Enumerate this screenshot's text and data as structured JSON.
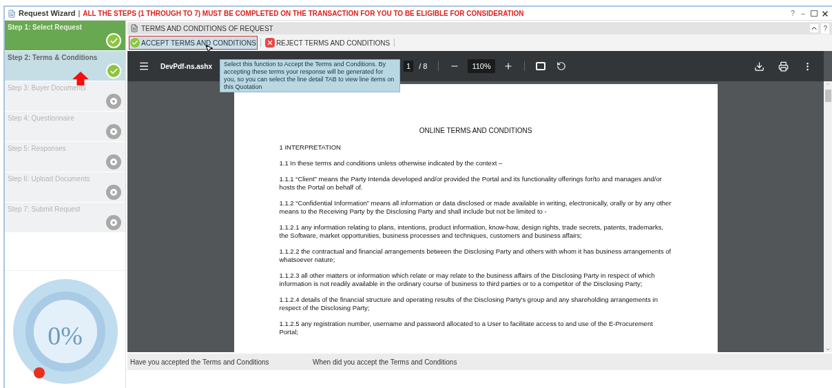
{
  "window": {
    "title": "Request Wizard",
    "separator": "|",
    "notice": "ALL THE STEPS (1 THROUGH TO 7) MUST BE COMPLETED ON THE TRANSACTION FOR YOU TO BE ELIGIBLE FOR CONSIDERATION",
    "controls": [
      "?",
      "–"
    ]
  },
  "steps": [
    {
      "label": "Step 1: Select Request",
      "completed": true,
      "selected": false
    },
    {
      "label": "Step 2: Terms & Conditions",
      "completed": true,
      "selected": true
    },
    {
      "label": "Step 3: Buyer Documents",
      "completed": false,
      "selected": false
    },
    {
      "label": "Step 4: Questionnaire",
      "completed": false,
      "selected": false
    },
    {
      "label": "Step 5: Responses",
      "completed": false,
      "selected": false
    },
    {
      "label": "Step 6: Upload Documents",
      "completed": false,
      "selected": false
    },
    {
      "label": "Step 7: Submit Request",
      "completed": false,
      "selected": false
    }
  ],
  "progress": {
    "text": "0%"
  },
  "panel": {
    "title": "TERMS AND CONDITIONS OF REQUEST",
    "help": "?"
  },
  "actions": [
    {
      "label": "ACCEPT TERMS AND CONDITIONS",
      "kind": "accept",
      "selected": true
    },
    {
      "label": "REJECT TERMS AND CONDITIONS",
      "kind": "reject",
      "selected": false
    }
  ],
  "tooltip": "Select this function to Accept the Terms and Conditions. By accepting these terms your response will be generated for you, so you can select the line detail TAB to view line items on this Quotation",
  "viewer": {
    "file": "DevPdf-ns.ashx",
    "page": "1",
    "pages": "/ 8",
    "zoom": "110%"
  },
  "document": {
    "title": "ONLINE TERMS AND CONDITIONS",
    "heading": "1 INTERPRETATION",
    "paragraphs": [
      "1.1 In these terms and conditions unless otherwise indicated by the context –",
      "1.1.1 “Client” means the Party Intenda developed and/or provided the Portal and its functionality offerings for/to and manages and/or hosts the Portal on behalf of.",
      "1.1.2 “Confidential Information” means all information or data disclosed or made available in writing, electronically, orally or by any other means to the Receiving Party by the Disclosing Party and shall include but not be limited to -",
      "1.1.2.1 any information relating to plans, intentions, product information, know-how, design rights, trade secrets, patents, trademarks, the Software, market opportunities, business processes and techniques, customers and business affairs;",
      "1.1.2.2 the contractual and financial arrangements between the Disclosing Party and others with whom it has business arrangements of whatsoever nature;",
      "1.1.2.3 all other matters or information which relate or may relate to the business affairs of the Disclosing Party in respect of which information is not readily available in the ordinary course of business to third parties or to a competitor of the Disclosing Party;",
      "1.1.2.4 details of the financial structure and operating results of the Disclosing Party's group and any shareholding arrangements in respect of the Disclosing Party;",
      "1.1.2.5 any registration number, username and password allocated to a User to facilitate access to and use of the E-Procurement Portal;"
    ]
  },
  "fields": [
    {
      "label": "Have you accepted the Terms and Conditions"
    },
    {
      "label": "When did you accept the Terms and Conditions"
    }
  ]
}
